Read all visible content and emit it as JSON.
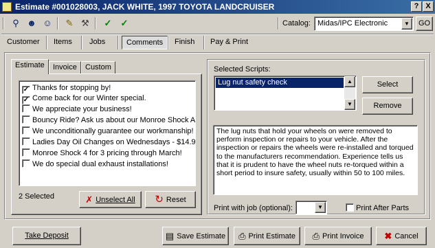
{
  "window": {
    "title": "Estimate #001028003, JACK WHITE, 1997 TOYOTA LANDCRUISER",
    "help_glyph": "?",
    "close_glyph": "X"
  },
  "toolbar": {
    "icons": [
      "search-person-icon",
      "person-check-icon",
      "person-add-icon",
      "notes-icon",
      "tools-icon",
      "check-icon",
      "check-icon"
    ],
    "catalog_label": "Catalog:",
    "catalog_value": "Midas/IPC Electronic",
    "go_label": "GO"
  },
  "nav_tabs": [
    "Customer",
    "Items",
    "Jobs",
    "Comments",
    "Finish",
    "Pay & Print"
  ],
  "nav_selected": "Comments",
  "comment_tabs": [
    "Estimate",
    "Invoice",
    "Custom"
  ],
  "comment_tab_selected": "Estimate",
  "comments": [
    {
      "text": "Thanks for stopping by!",
      "checked": true
    },
    {
      "text": "Come back for our Winter special.",
      "checked": true
    },
    {
      "text": "We appreciate your business!",
      "checked": false
    },
    {
      "text": "Bouncy Ride? Ask us about our Monroe Shock Abs",
      "checked": false
    },
    {
      "text": "We unconditionally guarantee our workmanship!",
      "checked": false
    },
    {
      "text": "Ladies Day Oil Changes on Wednesdays - $14.95",
      "checked": false
    },
    {
      "text": "Monroe Shock 4 for 3 pricing through March!",
      "checked": false
    },
    {
      "text": "We do special dual exhaust installations!",
      "checked": false
    }
  ],
  "selected_count": "2 Selected",
  "unselect_all_label": "Unselect All",
  "reset_label": "Reset",
  "scripts": {
    "label": "Selected Scripts:",
    "items": [
      "Lug nut safety check"
    ],
    "select_label": "Select",
    "remove_label": "Remove",
    "description": "The lug nuts that hold your wheels on were removed to perform inspection or repairs to your vehicle. After the inspection or repairs the wheels were re-installed and torqued to the manufacturers recommendation. Experience tells us that it is prudent to have the wheel nuts re-torqued within a short period to insure safety, usually within 50 to 100 miles.",
    "print_with_job_label": "Print with job (optional):",
    "print_with_job_value": "",
    "print_after_parts_label": "Print After Parts",
    "print_after_parts_checked": false
  },
  "footer": {
    "take_deposit": "Take Deposit",
    "save_estimate": "Save Estimate",
    "print_estimate": "Print Estimate",
    "print_invoice": "Print Invoice",
    "cancel": "Cancel"
  }
}
